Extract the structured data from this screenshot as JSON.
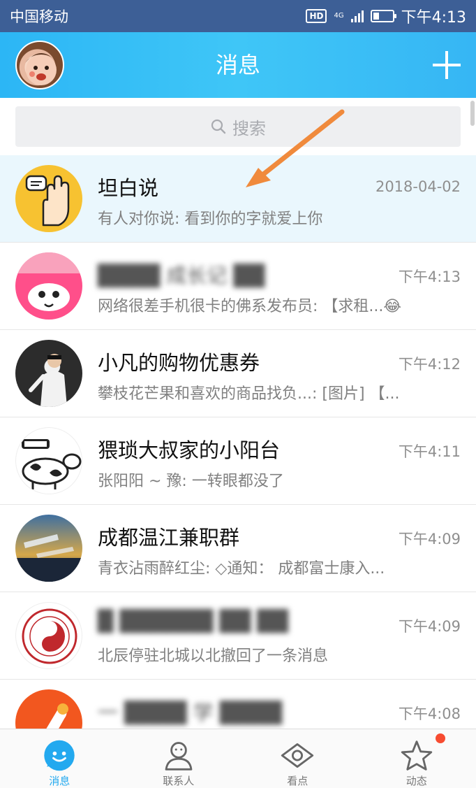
{
  "status_bar": {
    "carrier": "中国移动",
    "hd": "HD",
    "network": "4G",
    "time": "下午4:13"
  },
  "header": {
    "title": "消息"
  },
  "search": {
    "placeholder": "搜索"
  },
  "conversations": [
    {
      "name": "坦白说",
      "time": "2018-04-02",
      "preview": "有人对你说: 看到你的字就爱上你",
      "highlight": true,
      "blurred": false
    },
    {
      "name": "████ 成长记 ██",
      "time": "下午4:13",
      "preview": "网络很差手机很卡的佛系发布员: 【求租...😂",
      "highlight": false,
      "blurred": true
    },
    {
      "name": "小凡的购物优惠券",
      "time": "下午4:12",
      "preview": "攀枝花芒果和喜欢的商品找负...: [图片] 【...",
      "highlight": false,
      "blurred": false
    },
    {
      "name": "猥琐大叔家的小阳台",
      "time": "下午4:11",
      "preview": "张阳阳 ~ 豫: 一转眼都没了",
      "highlight": false,
      "blurred": false
    },
    {
      "name": "成都温江兼职群",
      "time": "下午4:09",
      "preview": "青衣沾雨醉红尘: ◇通知： 成都富士康入...",
      "highlight": false,
      "blurred": false
    },
    {
      "name": "█ ██████ ██ ██",
      "time": "下午4:09",
      "preview": "北辰停驻北城以北撤回了一条消息",
      "highlight": false,
      "blurred": true
    },
    {
      "name": "一 ████ 学 ████",
      "time": "下午4:08",
      "preview": "",
      "highlight": false,
      "blurred": true
    }
  ],
  "bottom_nav": [
    {
      "label": "消息",
      "icon": "message-icon",
      "active": true
    },
    {
      "label": "联系人",
      "icon": "contacts-icon",
      "active": false
    },
    {
      "label": "看点",
      "icon": "eye-icon",
      "active": false
    },
    {
      "label": "动态",
      "icon": "star-icon",
      "active": false
    }
  ],
  "colors": {
    "status_bar": "#3d5f96",
    "header_accent": "#2cb6f5",
    "active_tab": "#23a9ef",
    "annotation_arrow": "#f08a3c",
    "notification_dot": "#f74c31"
  }
}
